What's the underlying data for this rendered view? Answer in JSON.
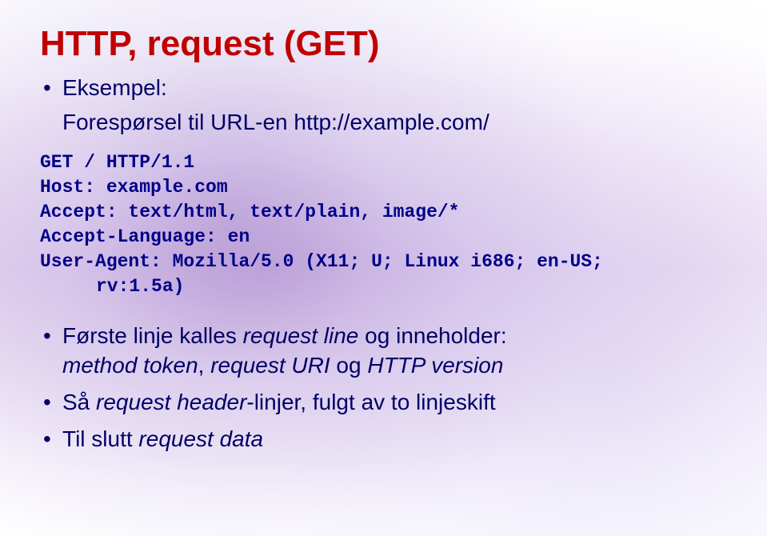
{
  "title": "HTTP, request (GET)",
  "intro": {
    "label": "Eksempel:",
    "description": "Forespørsel til URL-en http://example.com/"
  },
  "code": {
    "line1": "GET / HTTP/1.1",
    "line2": "Host: example.com",
    "line3": "Accept: text/html, text/plain, image/*",
    "line4": "Accept-Language: en",
    "line5": "User-Agent: Mozilla/5.0 (X11; U; Linux i686; en-US;",
    "line6": "rv:1.5a)"
  },
  "bullets": {
    "b1": {
      "prefix": "Første linje kalles ",
      "italic1": "request line",
      "mid": " og inneholder:",
      "line2_italic1": "method token",
      "line2_sep1": ", ",
      "line2_italic2": "request URI",
      "line2_sep2": " og ",
      "line2_italic3": "HTTP version"
    },
    "b2": {
      "prefix": "Så ",
      "italic": "request header",
      "suffix": "-linjer, fulgt av to linjeskift"
    },
    "b3": {
      "prefix": "Til slutt ",
      "italic": "request data"
    }
  }
}
